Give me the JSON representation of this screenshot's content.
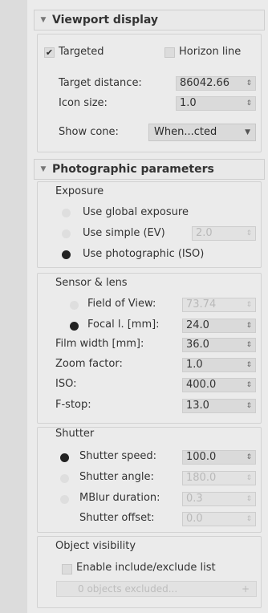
{
  "viewport": {
    "header": "Viewport display",
    "targeted_label": "Targeted",
    "targeted_checked": true,
    "horizon_label": "Horizon line",
    "horizon_checked": false,
    "target_distance_label": "Target distance:",
    "target_distance_value": "86042.66",
    "icon_size_label": "Icon size:",
    "icon_size_value": "1.0",
    "show_cone_label": "Show cone:",
    "show_cone_value": "When...cted"
  },
  "photo": {
    "header": "Photographic parameters",
    "exposure": {
      "title": "Exposure",
      "global_label": "Use global exposure",
      "simple_label": "Use simple (EV)",
      "simple_value": "2.0",
      "photographic_label": "Use photographic (ISO)",
      "selected": "photographic"
    },
    "sensor": {
      "title": "Sensor & lens",
      "fov_label": "Field of View:",
      "fov_value": "73.74",
      "focal_label": "Focal l. [mm]:",
      "focal_value": "24.0",
      "film_label": "Film width [mm]:",
      "film_value": "36.0",
      "zoom_label": "Zoom factor:",
      "zoom_value": "1.0",
      "iso_label": "ISO:",
      "iso_value": "400.0",
      "fstop_label": "F-stop:",
      "fstop_value": "13.0"
    },
    "shutter": {
      "title": "Shutter",
      "speed_label": "Shutter speed:",
      "speed_value": "100.0",
      "angle_label": "Shutter angle:",
      "angle_value": "180.0",
      "mblur_label": "MBlur duration:",
      "mblur_value": "0.3",
      "offset_label": "Shutter offset:",
      "offset_value": "0.0"
    },
    "visibility": {
      "title": "Object visibility",
      "enable_label": "Enable include/exclude list",
      "enable_checked": false,
      "excluded_text": "0 objects excluded..."
    }
  }
}
